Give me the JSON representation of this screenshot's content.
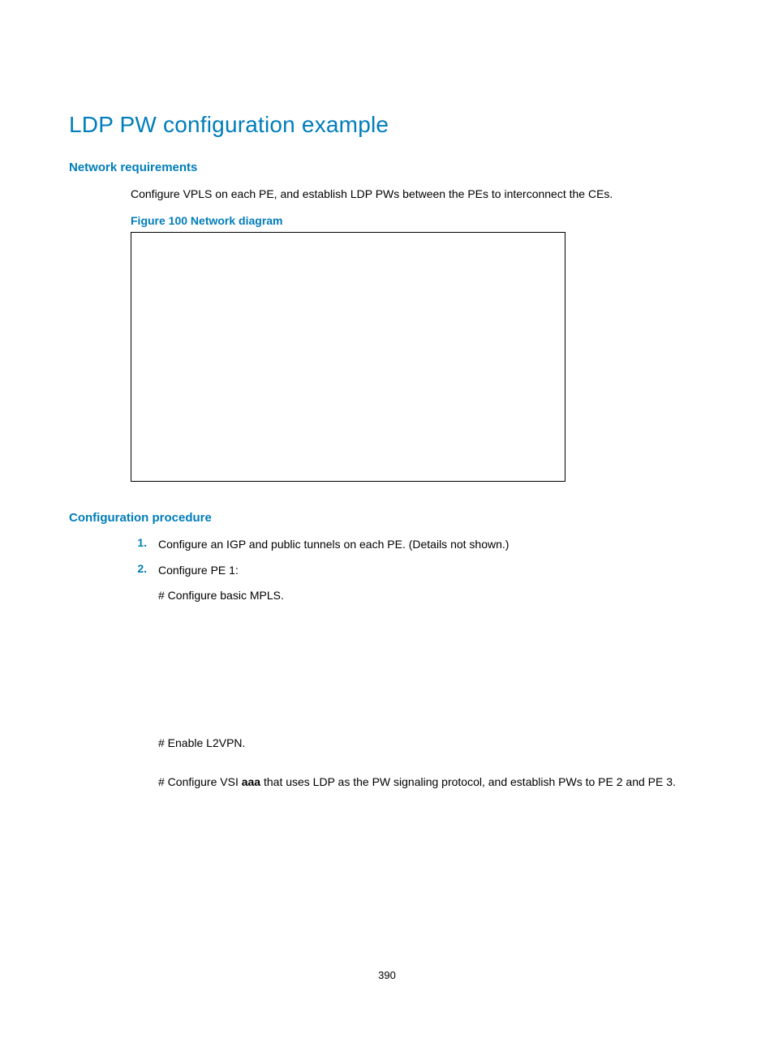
{
  "title": "LDP PW configuration example",
  "section1": {
    "heading": "Network requirements",
    "intro": "Configure VPLS on each PE, and establish LDP PWs between the PEs to interconnect the CEs.",
    "figure_caption": "Figure 100 Network diagram"
  },
  "section2": {
    "heading": "Configuration procedure",
    "steps": [
      {
        "num": "1.",
        "text": "Configure an IGP and public tunnels on each PE. (Details not shown.)"
      },
      {
        "num": "2.",
        "text": "Configure PE 1:"
      }
    ],
    "substep_a": "# Configure basic MPLS.",
    "substep_b": "# Enable L2VPN.",
    "substep_c_pre": "# Configure VSI ",
    "substep_c_bold": "aaa",
    "substep_c_post": " that uses LDP as the PW signaling protocol, and establish PWs to PE 2 and PE 3."
  },
  "page_number": "390"
}
